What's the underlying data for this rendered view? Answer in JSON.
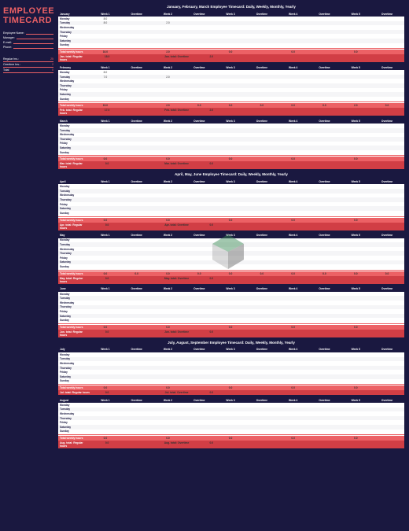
{
  "title1": "EMPLOYEE",
  "title2": "TIMECARD",
  "fields": [
    {
      "label": "Employee Name:"
    },
    {
      "label": "Manager:"
    },
    {
      "label": "E-mail:"
    },
    {
      "label": "Phone:"
    }
  ],
  "summary": [
    {
      "label": "Regular hrs.:",
      "val": "25"
    },
    {
      "label": "Overtime hrs.:",
      "val": "2"
    },
    {
      "label": "Total",
      "val": "0"
    }
  ],
  "cols": [
    "Week 1",
    "Overtime",
    "Week 2",
    "Overtime",
    "Week 3",
    "Overtime",
    "Week 4",
    "Overtime",
    "Week 5",
    "Overtime"
  ],
  "days": [
    "Monday",
    "Tuesday",
    "Wednesday",
    "Thursday",
    "Friday",
    "Saturday",
    "Sunday"
  ],
  "tot1_label": "Total weekly hours",
  "quarters": [
    {
      "title": "January, February, March     Employee Timecard: Daily, Weekly, Monthly, Yearly",
      "months": [
        {
          "name": "January",
          "rows": [
            [
              "8.0",
              "",
              "",
              "",
              "",
              "",
              "",
              "",
              "",
              ""
            ],
            [
              "8.0",
              "",
              "2.0",
              "",
              "",
              "",
              "",
              "",
              "",
              ""
            ],
            [
              "",
              "",
              "",
              "",
              "",
              "",
              "",
              "",
              "",
              ""
            ],
            [
              "",
              "",
              "",
              "",
              "",
              "",
              "",
              "",
              "",
              ""
            ],
            [
              "",
              "",
              "",
              "",
              "",
              "",
              "",
              "",
              "",
              ""
            ],
            [
              "",
              "",
              "",
              "",
              "",
              "",
              "",
              "",
              "",
              ""
            ],
            [
              "",
              "",
              "",
              "",
              "",
              "",
              "",
              "",
              "",
              ""
            ]
          ],
          "tot1": [
            "16.0",
            "",
            "2.0",
            "",
            "0.0",
            "",
            "0.0",
            "",
            "0.0",
            ""
          ],
          "tot2_l": "Jan. total: Regular hours",
          "tot2_v": "18.0",
          "tot2_l2": "Jan. total: Overtime",
          "tot2_v2": "2.0"
        },
        {
          "name": "February",
          "rows": [
            [
              "8.0",
              "",
              "",
              "",
              "",
              "",
              "",
              "",
              "",
              ""
            ],
            [
              "7.0",
              "",
              "2.0",
              "",
              "",
              "",
              "",
              "",
              "",
              ""
            ],
            [
              "",
              "",
              "",
              "",
              "",
              "",
              "",
              "",
              "",
              ""
            ],
            [
              "",
              "",
              "",
              "",
              "",
              "",
              "",
              "",
              "",
              ""
            ],
            [
              "",
              "",
              "",
              "",
              "",
              "",
              "",
              "",
              "",
              ""
            ],
            [
              "",
              "",
              "",
              "",
              "",
              "",
              "",
              "",
              "",
              ""
            ],
            [
              "",
              "",
              "",
              "",
              "",
              "",
              "",
              "",
              "",
              ""
            ]
          ],
          "tot1": [
            "15.0",
            "",
            "2.0",
            "0.0",
            "0.0",
            "0.0",
            "0.0",
            "0.0",
            "2.0",
            "0.0"
          ],
          "tot2_l": "Feb. total: Regular hours",
          "tot2_v": "17.0",
          "tot2_l2": "Feb. total: Overtime",
          "tot2_v2": "2.0"
        },
        {
          "name": "March",
          "rows": [
            [
              "",
              "",
              "",
              "",
              "",
              "",
              "",
              "",
              "",
              ""
            ],
            [
              "",
              "",
              "",
              "",
              "",
              "",
              "",
              "",
              "",
              ""
            ],
            [
              "",
              "",
              "",
              "",
              "",
              "",
              "",
              "",
              "",
              ""
            ],
            [
              "",
              "",
              "",
              "",
              "",
              "",
              "",
              "",
              "",
              ""
            ],
            [
              "",
              "",
              "",
              "",
              "",
              "",
              "",
              "",
              "",
              ""
            ],
            [
              "",
              "",
              "",
              "",
              "",
              "",
              "",
              "",
              "",
              ""
            ],
            [
              "",
              "",
              "",
              "",
              "",
              "",
              "",
              "",
              "",
              ""
            ]
          ],
          "tot1": [
            "0.0",
            "",
            "0.0",
            "",
            "0.0",
            "",
            "0.0",
            "",
            "0.0",
            ""
          ],
          "tot2_l": "Mar. total: Regular hours",
          "tot2_v": "0.0",
          "tot2_l2": "Mar. total: Overtime",
          "tot2_v2": "0.0"
        }
      ]
    },
    {
      "title": "April, May, June     Employee Timecard: Daily, Weekly, Monthly, Yearly",
      "months": [
        {
          "name": "April",
          "rows": [
            [
              "",
              "",
              "",
              "",
              "",
              "",
              "",
              "",
              "",
              ""
            ],
            [
              "",
              "",
              "",
              "",
              "",
              "",
              "",
              "",
              "",
              ""
            ],
            [
              "",
              "",
              "",
              "",
              "",
              "",
              "",
              "",
              "",
              ""
            ],
            [
              "",
              "",
              "",
              "",
              "",
              "",
              "",
              "",
              "",
              ""
            ],
            [
              "",
              "",
              "",
              "",
              "",
              "",
              "",
              "",
              "",
              ""
            ],
            [
              "",
              "",
              "",
              "",
              "",
              "",
              "",
              "",
              "",
              ""
            ],
            [
              "",
              "",
              "",
              "",
              "",
              "",
              "",
              "",
              "",
              ""
            ]
          ],
          "tot1": [
            "0.0",
            "",
            "0.0",
            "",
            "0.0",
            "",
            "0.0",
            "",
            "0.0",
            ""
          ],
          "tot2_l": "Apr. total: Regular hours",
          "tot2_v": "0.0",
          "tot2_l2": "Apr. total: Overtime",
          "tot2_v2": "0.0"
        },
        {
          "name": "May",
          "rows": [
            [
              "",
              "",
              "",
              "",
              "",
              "",
              "",
              "",
              "",
              ""
            ],
            [
              "",
              "",
              "",
              "",
              "",
              "",
              "",
              "",
              "",
              ""
            ],
            [
              "",
              "",
              "",
              "",
              "",
              "",
              "",
              "",
              "",
              ""
            ],
            [
              "",
              "",
              "",
              "",
              "",
              "",
              "",
              "",
              "",
              ""
            ],
            [
              "",
              "",
              "",
              "",
              "",
              "",
              "",
              "",
              "",
              ""
            ],
            [
              "",
              "",
              "",
              "",
              "",
              "",
              "",
              "",
              "",
              ""
            ],
            [
              "",
              "",
              "",
              "",
              "",
              "",
              "",
              "",
              "",
              ""
            ]
          ],
          "tot1": [
            "0.0",
            "0.0",
            "0.0",
            "0.0",
            "0.0",
            "0.0",
            "0.0",
            "0.0",
            "0.0",
            "0.0"
          ],
          "tot2_l": "May. total: Regular hours",
          "tot2_v": "0.0",
          "tot2_l2": "May. total: Overtime",
          "tot2_v2": "0.0"
        },
        {
          "name": "June",
          "rows": [
            [
              "",
              "",
              "",
              "",
              "",
              "",
              "",
              "",
              "",
              ""
            ],
            [
              "",
              "",
              "",
              "",
              "",
              "",
              "",
              "",
              "",
              ""
            ],
            [
              "",
              "",
              "",
              "",
              "",
              "",
              "",
              "",
              "",
              ""
            ],
            [
              "",
              "",
              "",
              "",
              "",
              "",
              "",
              "",
              "",
              ""
            ],
            [
              "",
              "",
              "",
              "",
              "",
              "",
              "",
              "",
              "",
              ""
            ],
            [
              "",
              "",
              "",
              "",
              "",
              "",
              "",
              "",
              "",
              ""
            ],
            [
              "",
              "",
              "",
              "",
              "",
              "",
              "",
              "",
              "",
              ""
            ]
          ],
          "tot1": [
            "0.0",
            "",
            "0.0",
            "",
            "0.0",
            "",
            "0.0",
            "",
            "0.0",
            ""
          ],
          "tot2_l": "Jun. total: Regular hours",
          "tot2_v": "0.0",
          "tot2_l2": "Jun. total: Overtime",
          "tot2_v2": "0.0"
        }
      ]
    },
    {
      "title": "July, August, September     Employee Timecard: Daily, Weekly, Monthly, Yearly",
      "months": [
        {
          "name": "July",
          "rows": [
            [
              "",
              "",
              "",
              "",
              "",
              "",
              "",
              "",
              "",
              ""
            ],
            [
              "",
              "",
              "",
              "",
              "",
              "",
              "",
              "",
              "",
              ""
            ],
            [
              "",
              "",
              "",
              "",
              "",
              "",
              "",
              "",
              "",
              ""
            ],
            [
              "",
              "",
              "",
              "",
              "",
              "",
              "",
              "",
              "",
              ""
            ],
            [
              "",
              "",
              "",
              "",
              "",
              "",
              "",
              "",
              "",
              ""
            ],
            [
              "",
              "",
              "",
              "",
              "",
              "",
              "",
              "",
              "",
              ""
            ],
            [
              "",
              "",
              "",
              "",
              "",
              "",
              "",
              "",
              "",
              ""
            ]
          ],
          "tot1": [
            "0.0",
            "",
            "0.0",
            "",
            "0.0",
            "",
            "0.0",
            "",
            "0.0",
            ""
          ],
          "tot2_l": "Jul. total: Regular hours",
          "tot2_v": "0.0",
          "tot2_l2": "Jul. total: Overtime",
          "tot2_v2": "0.0"
        },
        {
          "name": "August",
          "rows": [
            [
              "",
              "",
              "",
              "",
              "",
              "",
              "",
              "",
              "",
              ""
            ],
            [
              "",
              "",
              "",
              "",
              "",
              "",
              "",
              "",
              "",
              ""
            ],
            [
              "",
              "",
              "",
              "",
              "",
              "",
              "",
              "",
              "",
              ""
            ],
            [
              "",
              "",
              "",
              "",
              "",
              "",
              "",
              "",
              "",
              ""
            ],
            [
              "",
              "",
              "",
              "",
              "",
              "",
              "",
              "",
              "",
              ""
            ],
            [
              "",
              "",
              "",
              "",
              "",
              "",
              "",
              "",
              "",
              ""
            ],
            [
              "",
              "",
              "",
              "",
              "",
              "",
              "",
              "",
              "",
              ""
            ]
          ],
          "tot1": [
            "0.0",
            "",
            "0.0",
            "",
            "0.0",
            "",
            "0.0",
            "",
            "0.0",
            ""
          ],
          "tot2_l": "Aug. total: Regular hours",
          "tot2_v": "0.0",
          "tot2_l2": "Aug. total: Overtime",
          "tot2_v2": "0.0"
        }
      ]
    }
  ]
}
